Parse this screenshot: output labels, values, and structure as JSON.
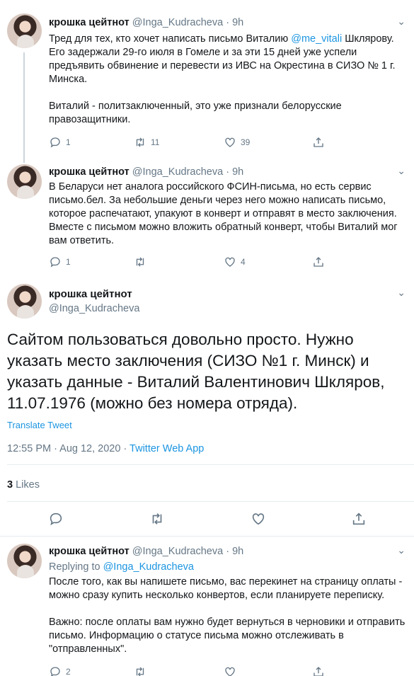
{
  "tweets": [
    {
      "name": "крошка цейтнот",
      "handle": "@Inga_Kudracheva",
      "dot": "·",
      "time": "9h",
      "paragraphs": [
        {
          "before": "Тред для тех, кто хочет написать письмо Виталию ",
          "mention": "@me_vitali",
          "after": " Шклярову. Его задержали 29-го июля в Гомеле и за эти 15 дней уже успели предъявить обвинение и перевести из ИВС на Окрестина в СИЗО № 1 г. Минска."
        },
        {
          "before": "Виталий - политзаключенный, это уже признали белорусские правозащитники.",
          "mention": "",
          "after": ""
        }
      ],
      "replies": "1",
      "retweets": "11",
      "likes": "39"
    },
    {
      "name": "крошка цейтнот",
      "handle": "@Inga_Kudracheva",
      "dot": "·",
      "time": "9h",
      "paragraphs": [
        {
          "before": "В Беларуси нет аналога российского ФСИН-письма, но есть сервис письмо.бел. За небольшие деньги через него можно написать письмо, которое распечатают, упакуют в конверт и отправят в место заключения. Вместе с письмом можно вложить обратный конверт, чтобы Виталий мог вам ответить.",
          "mention": "",
          "after": ""
        }
      ],
      "replies": "1",
      "retweets": "",
      "likes": "4"
    }
  ],
  "main": {
    "name": "крошка цейтнот",
    "handle": "@Inga_Kudracheva",
    "text": "Сайтом пользоваться довольно просто. Нужно указать место заключения (СИЗО №1 г. Минск) и указать данные - Виталий Валентинович Шкляров, 11.07.1976 (можно без номера отряда).",
    "translate": "Translate Tweet",
    "timestamp": "12:55 PM · Aug 12, 2020 · ",
    "source": "Twitter Web App",
    "likes_count": "3",
    "likes_label": " Likes"
  },
  "reply": {
    "name": "крошка цейтнот",
    "handle": "@Inga_Kudracheva",
    "dot": "·",
    "time": "9h",
    "replying_prefix": "Replying to ",
    "replying_to": "@Inga_Kudracheva",
    "paragraphs": [
      "После того, как вы напишете письмо, вас перекинет на страницу оплаты - можно сразу купить несколько конвертов, если планируете переписку.",
      "Важно: после оплаты вам нужно будет вернуться в черновики и отправить письмо. Информацию о статусе письма можно отслеживать в \"отправленных\"."
    ],
    "replies": "2"
  },
  "icons": {
    "reply": "reply-icon",
    "retweet": "retweet-icon",
    "like": "heart-icon",
    "share": "share-icon",
    "more": "chevron-down-icon"
  },
  "colors": {
    "accent": "#1b95e0",
    "muted": "#657786",
    "text": "#14171a",
    "border": "#e6ecf0"
  }
}
